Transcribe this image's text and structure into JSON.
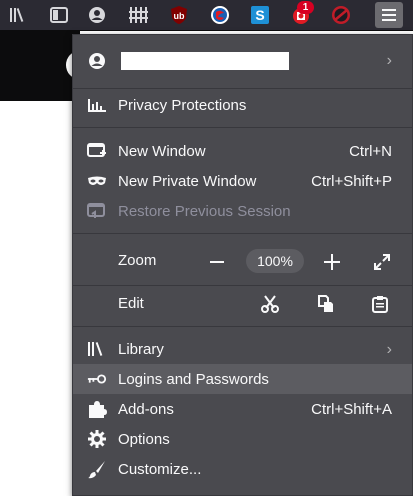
{
  "toolbar": {
    "icons": [
      "library-icon",
      "sidebar-icon",
      "account-icon",
      "bookmarks-grid-icon",
      "ublock-icon",
      "extension-red-icon",
      "extension-s-icon",
      "extension-alert-icon",
      "block-icon",
      "hamburger-menu-icon"
    ],
    "badge_count": "1"
  },
  "menu": {
    "privacy": "Privacy Protections",
    "new_window": {
      "label": "New Window",
      "shortcut": "Ctrl+N"
    },
    "new_private": {
      "label": "New Private Window",
      "shortcut": "Ctrl+Shift+P"
    },
    "restore": {
      "label": "Restore Previous Session"
    },
    "zoom": {
      "label": "Zoom",
      "value": "100%"
    },
    "edit": {
      "label": "Edit"
    },
    "library": {
      "label": "Library"
    },
    "logins": {
      "label": "Logins and Passwords"
    },
    "addons": {
      "label": "Add-ons",
      "shortcut": "Ctrl+Shift+A"
    },
    "options": {
      "label": "Options"
    },
    "customize": {
      "label": "Customize..."
    }
  },
  "colors": {
    "panel": "#4a4a4f",
    "toolbar": "#2b2a33",
    "hover": "#5c5c61",
    "badge": "#d70022"
  }
}
